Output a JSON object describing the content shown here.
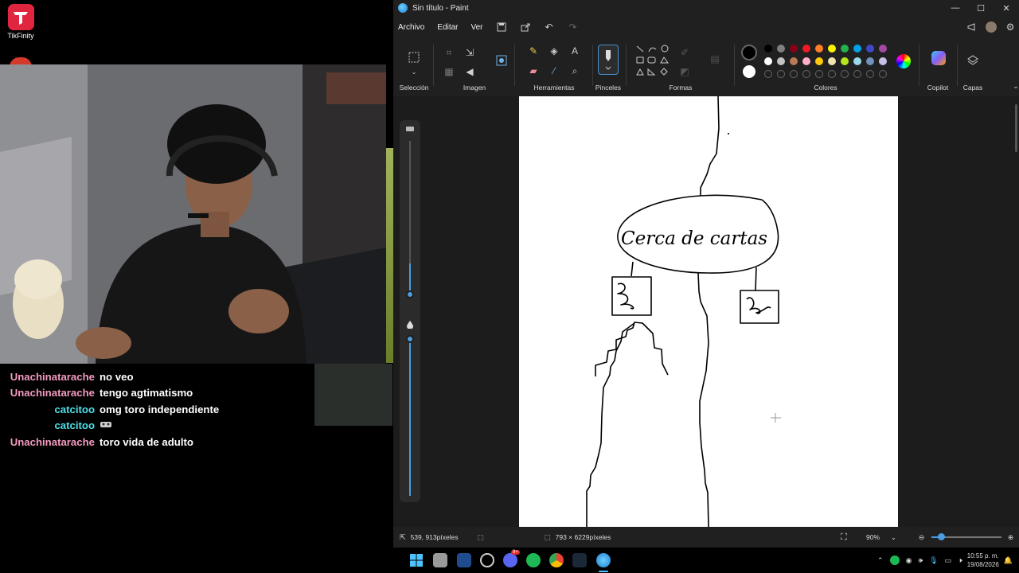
{
  "overlay": {
    "tikfinity_label": "TikFinity"
  },
  "chat": [
    {
      "user": "Unachinatarache",
      "message": "no veo",
      "color": "#f39ac0"
    },
    {
      "user": "Unachinatarache",
      "message": "tengo agtimatismo",
      "color": "#f39ac0"
    },
    {
      "user": "catcitoo",
      "message": "omg toro independiente",
      "color": "#4ee0e8"
    },
    {
      "user": "catcitoo",
      "message": "",
      "color": "#4ee0e8"
    },
    {
      "user": "Unachinatarache",
      "message": "toro vida de adulto",
      "color": "#f39ac0"
    }
  ],
  "paint": {
    "window_title": "Sin título - Paint",
    "menu": [
      "Archivo",
      "Editar",
      "Ver"
    ],
    "groups": {
      "seleccion": "Selección",
      "imagen": "Imagen",
      "herramientas": "Herramientas",
      "pinceles": "Pinceles",
      "formas": "Formas",
      "colores": "Colores",
      "copilot": "Copilot",
      "capas": "Capas"
    },
    "palette_row1": [
      "#000000",
      "#7f7f7f",
      "#880015",
      "#ed1c24",
      "#ff7f27",
      "#fff200",
      "#22b14c",
      "#00a2e8",
      "#3f48cc",
      "#a349a4"
    ],
    "palette_row2": [
      "#ffffff",
      "#c3c3c3",
      "#b97a57",
      "#ffaec9",
      "#ffc90e",
      "#efe4b0",
      "#b5e61d",
      "#99d9ea",
      "#7092be",
      "#c8bfe7"
    ],
    "drawing_text": "Cerca de cartas",
    "status": {
      "cursor_pos": "539, 913píxeles",
      "canvas_size": "793 × 6229píxeles",
      "zoom": "90%"
    }
  },
  "taskbar": {
    "time": "10:55 p. m.",
    "date": "19/08/2026",
    "discord_badge": "9+"
  }
}
